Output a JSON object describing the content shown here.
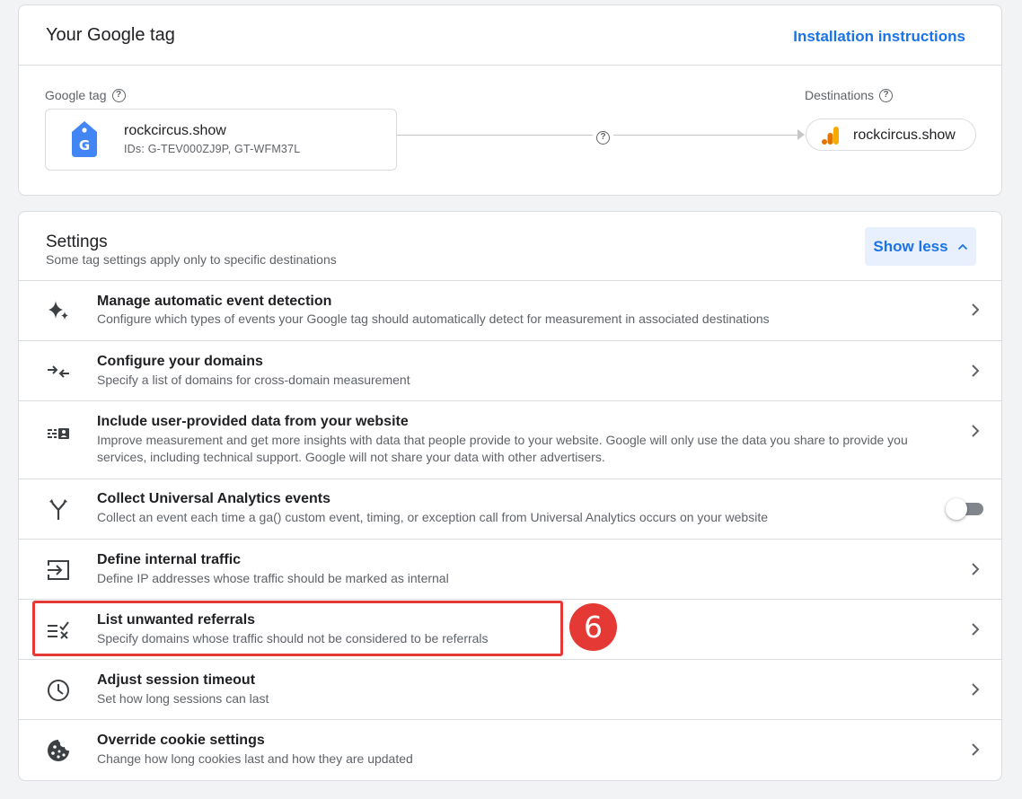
{
  "tag_card": {
    "title": "Your Google tag",
    "install_link": "Installation instructions",
    "google_tag_label": "Google tag",
    "tag_name": "rockcircus.show",
    "tag_ids": "IDs: G-TEV000ZJ9P, GT-WFM37L",
    "destinations_label": "Destinations",
    "destination_name": "rockcircus.show"
  },
  "settings": {
    "title": "Settings",
    "subtitle": "Some tag settings apply only to specific destinations",
    "show_less_label": "Show less",
    "items": [
      {
        "title": "Manage automatic event detection",
        "desc": "Configure which types of events your Google tag should automatically detect for measurement in associated destinations",
        "icon": "sparkle-icon",
        "control": "chevron"
      },
      {
        "title": "Configure your domains",
        "desc": "Specify a list of domains for cross-domain measurement",
        "icon": "merge-arrows-icon",
        "control": "chevron"
      },
      {
        "title": "Include user-provided data from your website",
        "desc": "Improve measurement and get more insights with data that people provide to your website. Google will only use the data you share to provide you services, including technical support. Google will not share your data with other advertisers.",
        "icon": "contact-data-icon",
        "control": "chevron"
      },
      {
        "title": "Collect Universal Analytics events",
        "desc": "Collect an event each time a ga() custom event, timing, or exception call from Universal Analytics occurs on your website",
        "icon": "fork-icon",
        "control": "toggle",
        "toggle_on": false
      },
      {
        "title": "Define internal traffic",
        "desc": "Define IP addresses whose traffic should be marked as internal",
        "icon": "input-arrow-icon",
        "control": "chevron"
      },
      {
        "title": "List unwanted referrals",
        "desc": "Specify domains whose traffic should not be considered to be referrals",
        "icon": "list-exclude-icon",
        "control": "chevron"
      },
      {
        "title": "Adjust session timeout",
        "desc": "Set how long sessions can last",
        "icon": "clock-icon",
        "control": "chevron"
      },
      {
        "title": "Override cookie settings",
        "desc": "Change how long cookies last and how they are updated",
        "icon": "cookie-icon",
        "control": "chevron"
      }
    ]
  },
  "annotation": {
    "step_number": "6",
    "color": "#e53935"
  },
  "colors": {
    "accent": "#1a73e8",
    "tag_blue": "#4285f4",
    "ga_orange": "#f9ab00",
    "ga_dark_orange": "#e37400"
  }
}
